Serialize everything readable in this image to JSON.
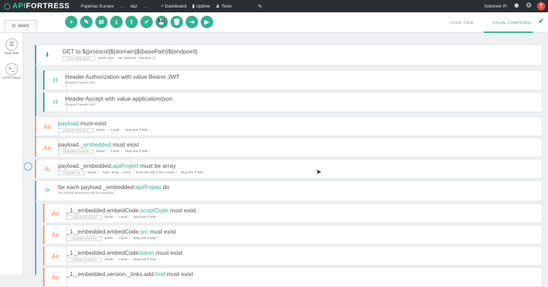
{
  "app": {
    "logo_part1": "API",
    "logo_part2": "FORTRESS",
    "company": "Pajamas Europe",
    "project": "daz",
    "nav": [
      {
        "label": "Dashboard",
        "icon": "chart-icon"
      },
      {
        "label": "Uptime",
        "icon": "bar-chart-icon"
      },
      {
        "label": "Tests",
        "icon": "users-icon"
      }
    ],
    "user": "Solomon Pi"
  },
  "toolbar": {
    "file_tab": "apiary",
    "buttons": [
      "+",
      "✎",
      "⇄",
      "⭳",
      "⭱",
      "✔",
      "💾",
      "🗑",
      "⇥",
      "▶"
    ],
    "code_view": "CODE VIEW",
    "visual_composer": "VISUAL COMPOSER"
  },
  "sidebar": [
    {
      "label": "Data Sets",
      "icon": "list-icon",
      "glyph": "☰"
    },
    {
      "label": "HTTP Client",
      "icon": "terminal-icon",
      "glyph": ">_"
    }
  ],
  "blocks": {
    "get": {
      "title": "GET to ${protocol}${domain}${basePath}${endpoint}",
      "pill": "GET REQUEST",
      "mode": "Mode: json",
      "var": "Var: payload",
      "params": "Params: [ ]",
      "icon": "⬇"
    },
    "h1": {
      "title": "Header Authorization with value Bearer JWT",
      "sub": "Request header item",
      "icon": "H"
    },
    "h2": {
      "title": "Header Accept with value application/json",
      "sub": "Request header item",
      "icon": "H"
    },
    "a1": {
      "t1": "payload",
      "t2": " must exist",
      "pill": "ASSERT EXISTS",
      "mode": "Mode: -",
      "level": "Level: -",
      "stop": "Stop test if fails: -",
      "icon": "Ae"
    },
    "a2": {
      "t0": "payload.",
      "t1": "_embedded",
      "t2": " must exist",
      "pill": "ASSERT EXISTS",
      "mode": "Mode: -",
      "level": "Level: -",
      "stop": "Stop test if fails: -",
      "icon": "Ae"
    },
    "a3": {
      "t0": "payload._embedded.",
      "t1": "apiProject",
      "t2": " must be array",
      "pill": "ASSERT IS",
      "mode": "Mode: -",
      "type": "Type: array",
      "level": "Level: -",
      "exec": "Execute only if item exists: -",
      "stop": "Stop test if fails: -",
      "icon": "Ai"
    },
    "each": {
      "t0": "for each ",
      "t1": "payload._embedded.",
      "t2": "apiProject",
      "t3": " do",
      "sub": "the nested assertions will be executed",
      "icon": "⟳"
    },
    "b1": {
      "t0": "_1._embedded.embedCode.",
      "t1": "scriptCode",
      "t2": " must exist",
      "pill": "ASSERT EXISTS",
      "mode": "Mode: -",
      "level": "Level: -",
      "stop": "Stop test if fails: -",
      "icon": "Ae"
    },
    "b2": {
      "t0": "_1._embedded.embedCode.",
      "t1": "src",
      "t2": " must exist",
      "pill": "ASSERT EXISTS",
      "mode": "Mode: -",
      "level": "Level: -",
      "stop": "Stop test if fails: -",
      "icon": "Ae"
    },
    "b3": {
      "t0": "_1._embedded.embedCode.",
      "t1": "token",
      "t2": " must exist",
      "pill": "ASSERT EXISTS",
      "mode": "Mode: -",
      "level": "Level: -",
      "stop": "Stop test if fails: -",
      "icon": "Ae"
    },
    "b4": {
      "t0": "_1._embedded.version._links.add.",
      "t1": "href",
      "t2": " must exist",
      "icon": "Ae"
    }
  },
  "colors": {
    "accent": "#2fb391",
    "assert": "#f29b7c",
    "info": "#5ba4d6",
    "topbar": "#2a2f33",
    "help": "#e74c3c"
  }
}
